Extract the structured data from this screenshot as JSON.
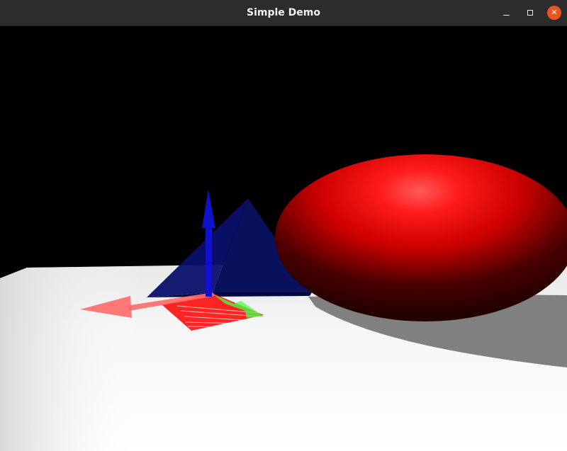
{
  "window": {
    "title": "Simple Demo",
    "controls": {
      "minimize_icon": "minimize-icon",
      "maximize_icon": "maximize-icon",
      "close_icon": "close-icon",
      "close_glyph": "✕"
    }
  },
  "scene": {
    "background_color": "#000000",
    "objects": [
      {
        "name": "ground-plane",
        "color": "#ffffff"
      },
      {
        "name": "sphere",
        "color": "#ff0000"
      },
      {
        "name": "pyramid",
        "color": "#0a0a66"
      },
      {
        "name": "axis-x-arrow",
        "color": "#ff6a6a"
      },
      {
        "name": "axis-y-arrow",
        "color": "#44ff44"
      },
      {
        "name": "axis-z-arrow",
        "color": "#1111cc"
      },
      {
        "name": "shadow",
        "color": "#808080"
      }
    ]
  }
}
